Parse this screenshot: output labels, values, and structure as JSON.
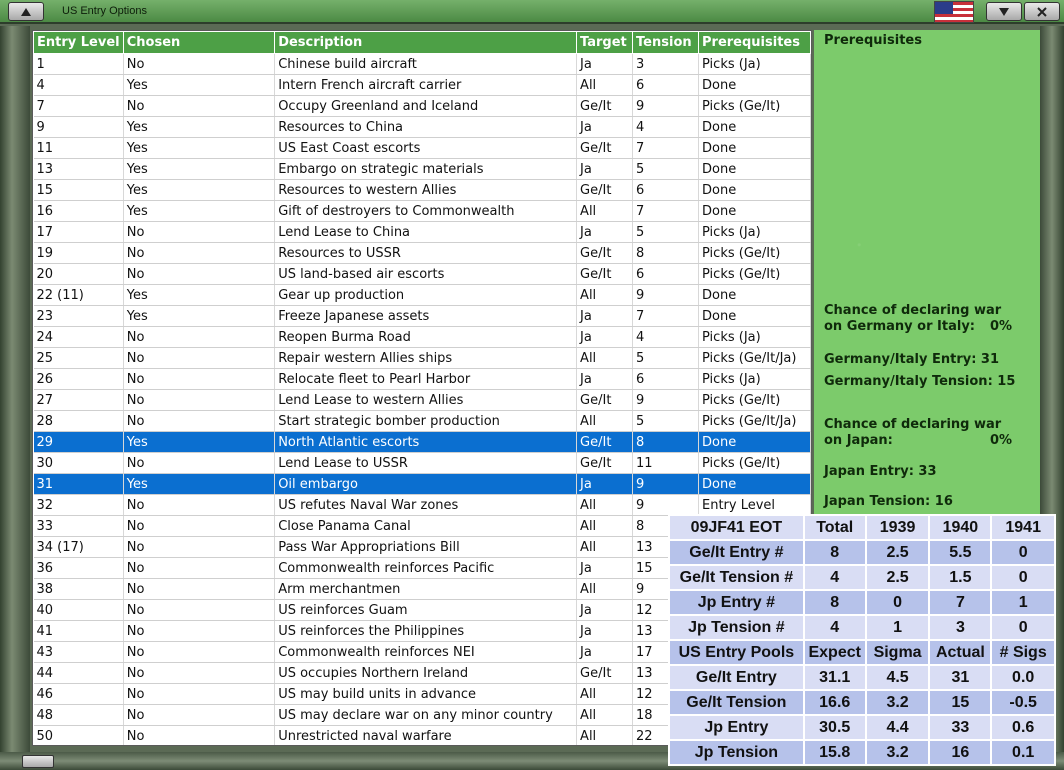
{
  "window": {
    "title": "US Entry Options"
  },
  "table": {
    "columns": [
      "Entry Level",
      "Chosen",
      "Description",
      "Target",
      "Tension",
      "Prerequisites"
    ],
    "rows": [
      [
        "1",
        "No",
        "Chinese build aircraft",
        "Ja",
        "3",
        "Picks (Ja)"
      ],
      [
        "4",
        "Yes",
        "Intern French aircraft carrier",
        "All",
        "6",
        "Done"
      ],
      [
        "7",
        "No",
        "Occupy Greenland and Iceland",
        "Ge/It",
        "9",
        "Picks (Ge/It)"
      ],
      [
        "9",
        "Yes",
        "Resources to China",
        "Ja",
        "4",
        "Done"
      ],
      [
        "11",
        "Yes",
        "US East Coast escorts",
        "Ge/It",
        "7",
        "Done"
      ],
      [
        "13",
        "Yes",
        "Embargo on strategic materials",
        "Ja",
        "5",
        "Done"
      ],
      [
        "15",
        "Yes",
        "Resources to western Allies",
        "Ge/It",
        "6",
        "Done"
      ],
      [
        "16",
        "Yes",
        "Gift of destroyers to Commonwealth",
        "All",
        "7",
        "Done"
      ],
      [
        "17",
        "No",
        "Lend Lease to China",
        "Ja",
        "5",
        "Picks (Ja)"
      ],
      [
        "19",
        "No",
        "Resources to USSR",
        "Ge/It",
        "8",
        "Picks (Ge/It)"
      ],
      [
        "20",
        "No",
        "US land-based air escorts",
        "Ge/It",
        "6",
        "Picks (Ge/It)"
      ],
      [
        "22 (11)",
        "Yes",
        "Gear up production",
        "All",
        "9",
        "Done"
      ],
      [
        "23",
        "Yes",
        "Freeze Japanese assets",
        "Ja",
        "7",
        "Done"
      ],
      [
        "24",
        "No",
        "Reopen Burma Road",
        "Ja",
        "4",
        "Picks (Ja)"
      ],
      [
        "25",
        "No",
        "Repair western Allies ships",
        "All",
        "5",
        "Picks (Ge/It/Ja)"
      ],
      [
        "26",
        "No",
        "Relocate fleet to Pearl Harbor",
        "Ja",
        "6",
        "Picks (Ja)"
      ],
      [
        "27",
        "No",
        "Lend Lease to western Allies",
        "Ge/It",
        "9",
        "Picks (Ge/It)"
      ],
      [
        "28",
        "No",
        "Start strategic bomber production",
        "All",
        "5",
        "Picks (Ge/It/Ja)"
      ],
      [
        "29",
        "Yes",
        "North Atlantic escorts",
        "Ge/It",
        "8",
        "Done"
      ],
      [
        "30",
        "No",
        "Lend Lease to USSR",
        "Ge/It",
        "11",
        "Picks (Ge/It)"
      ],
      [
        "31",
        "Yes",
        "Oil embargo",
        "Ja",
        "9",
        "Done"
      ],
      [
        "32",
        "No",
        "US refutes Naval War zones",
        "All",
        "9",
        "Entry Level"
      ],
      [
        "33",
        "No",
        "Close Panama Canal",
        "All",
        "8",
        ""
      ],
      [
        "34 (17)",
        "No",
        "Pass War Appropriations Bill",
        "All",
        "13",
        ""
      ],
      [
        "36",
        "No",
        "Commonwealth reinforces Pacific",
        "Ja",
        "15",
        ""
      ],
      [
        "38",
        "No",
        "Arm merchantmen",
        "All",
        "9",
        ""
      ],
      [
        "40",
        "No",
        "US reinforces Guam",
        "Ja",
        "12",
        ""
      ],
      [
        "41",
        "No",
        "US reinforces the Philippines",
        "Ja",
        "13",
        ""
      ],
      [
        "43",
        "No",
        "Commonwealth reinforces NEI",
        "Ja",
        "17",
        ""
      ],
      [
        "44",
        "No",
        "US occupies Northern Ireland",
        "Ge/It",
        "13",
        ""
      ],
      [
        "46",
        "No",
        "US may build units in advance",
        "All",
        "12",
        ""
      ],
      [
        "48",
        "No",
        "US may declare war on any minor country",
        "All",
        "18",
        ""
      ],
      [
        "50",
        "No",
        "Unrestricted naval warfare",
        "All",
        "22",
        ""
      ]
    ],
    "selected_rows": [
      "29",
      "31"
    ]
  },
  "side": {
    "prereq_heading": "Prerequisites",
    "chance_ge_line1": "Chance of declaring war",
    "chance_ge_line2": "on Germany or Italy:",
    "chance_ge_value": "0%",
    "ge_entry": "Germany/Italy Entry: 31",
    "ge_tension": "Germany/Italy Tension: 15",
    "chance_ja_line1": "Chance of declaring war",
    "chance_ja_line2": "on Japan:",
    "chance_ja_value": "0%",
    "ja_entry": "Japan Entry: 33",
    "ja_tension": "Japan Tension: 16"
  },
  "stats": {
    "rows": [
      [
        "09JF41 EOT",
        "Total",
        "1939",
        "1940",
        "1941"
      ],
      [
        "Ge/It Entry #",
        "8",
        "2.5",
        "5.5",
        "0"
      ],
      [
        "Ge/It Tension #",
        "4",
        "2.5",
        "1.5",
        "0"
      ],
      [
        "Jp Entry #",
        "8",
        "0",
        "7",
        "1"
      ],
      [
        "Jp Tension #",
        "4",
        "1",
        "3",
        "0"
      ],
      [
        "US Entry Pools",
        "Expect",
        "Sigma",
        "Actual",
        "# Sigs"
      ],
      [
        "Ge/It Entry",
        "31.1",
        "4.5",
        "31",
        "0.0"
      ],
      [
        "Ge/It Tension",
        "16.6",
        "3.2",
        "15",
        "-0.5"
      ],
      [
        "Jp Entry",
        "30.5",
        "4.4",
        "33",
        "0.6"
      ],
      [
        "Jp Tension",
        "15.8",
        "3.2",
        "16",
        "0.1"
      ]
    ]
  },
  "colors": {
    "header_green": "#4da046",
    "selected_blue": "#0b6fd0",
    "side_panel_green": "#7ccb6b"
  },
  "icons": {
    "flag": "us-flag-icon",
    "window_menu": "window-menu-icon",
    "window_close": "window-close-icon"
  }
}
